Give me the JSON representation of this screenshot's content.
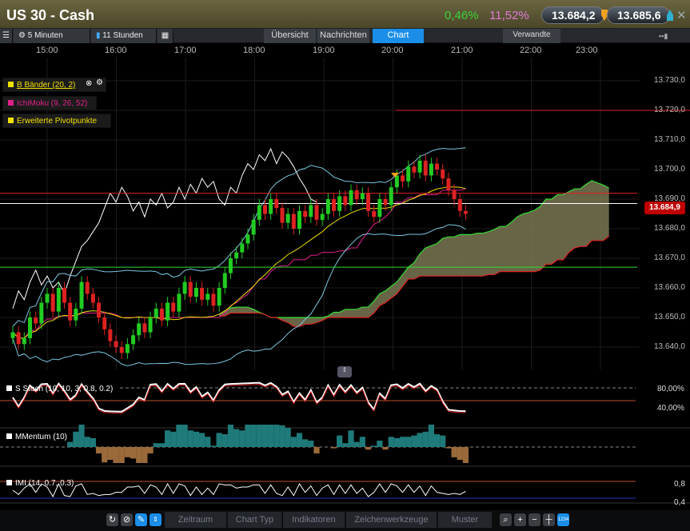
{
  "header": {
    "title": "US 30 - Cash",
    "change_pct": "0,46%",
    "change_pct2": "11,52%",
    "bid": "13.684,2",
    "ask": "13.685,6"
  },
  "toolbar": {
    "interval": "5 Minuten",
    "range": "11 Stunden",
    "tabs": [
      "Übersicht",
      "Nachrichten",
      "Chart"
    ],
    "related": "Verwandte"
  },
  "time_axis": [
    "15:00",
    "16:00",
    "17:00",
    "18:00",
    "19:00",
    "20:00",
    "21:00",
    "22:00",
    "23:00"
  ],
  "price_axis": [
    "13.730,0",
    "13.720,0",
    "13.710,0",
    "13.700,0",
    "13.690,0",
    "13.680,0",
    "13.670,0",
    "13.660,0",
    "13.650,0",
    "13.640,0"
  ],
  "current_price": "13.684,9",
  "legend": [
    {
      "label": "B Bänder (20, 2)",
      "color": "#f0e000"
    },
    {
      "label": "IchiMoku (9, 26, 52)",
      "color": "#e0208a"
    },
    {
      "label": "Erweiterte Pivotpunkte",
      "color": "#f0e000"
    }
  ],
  "panels": [
    {
      "label": "S Stoch (10, 10, 3, 0.8, 0.2)",
      "levels": [
        "80,00%",
        "40,00%"
      ]
    },
    {
      "label": "MMentum (10)",
      "levels": []
    },
    {
      "label": "IMI (14, 0.7, 0.3)",
      "levels": [
        "0,8",
        "0,4"
      ]
    }
  ],
  "bottom": {
    "menus": [
      "Zeitraum",
      "Chart Typ",
      "Indikatoren",
      "Zeichenwerkzeuge",
      "Muster"
    ]
  },
  "colors": {
    "up": "#22cc22",
    "down": "#dd2222",
    "cloud": "#7a7552"
  },
  "chart_data": {
    "type": "candlestick",
    "interval_min": 5,
    "start": "14:30",
    "closes": [
      13645,
      13641,
      13643,
      13650,
      13648,
      13655,
      13658,
      13652,
      13660,
      13655,
      13649,
      13653,
      13662,
      13658,
      13655,
      13650,
      13646,
      13642,
      13640,
      13638,
      13641,
      13644,
      13648,
      13645,
      13650,
      13653,
      13649,
      13655,
      13652,
      13658,
      13662,
      13657,
      13660,
      13656,
      13658,
      13654,
      13660,
      13665,
      13670,
      13672,
      13675,
      13678,
      13683,
      13688,
      13685,
      13690,
      13687,
      13682,
      13685,
      13680,
      13686,
      13684,
      13688,
      13683,
      13685,
      13690,
      13686,
      13691,
      13688,
      13693,
      13690,
      13692,
      13686,
      13684,
      13690,
      13688,
      13694,
      13698,
      13696,
      13701,
      13699,
      13703,
      13698,
      13702,
      13700,
      13697,
      13693,
      13690,
      13686,
      13685
    ],
    "levels": [
      13720,
      13692,
      13688.5,
      13667
    ],
    "ylim": [
      13634,
      13738
    ]
  }
}
